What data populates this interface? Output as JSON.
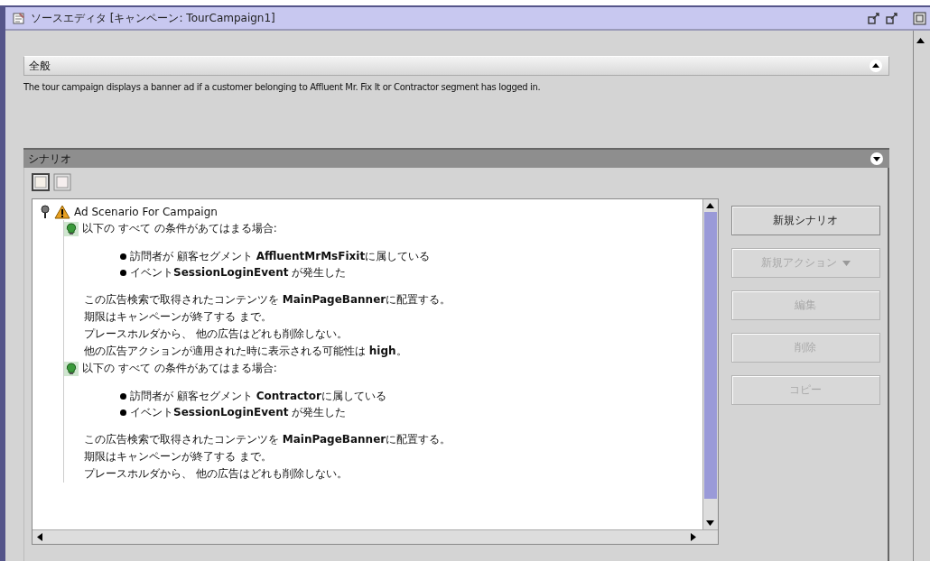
{
  "window": {
    "title": "ソースエディタ [キャンペーン: TourCampaign1]"
  },
  "sections": [
    {
      "kind": "light",
      "title": "全般",
      "description": "The tour campaign displays a banner ad if a customer belonging to Affluent Mr. Fix It or Contractor segment has logged in."
    },
    {
      "kind": "dark",
      "title": "シナリオ",
      "tree": [
        {
          "kind": "scenario",
          "text": "Ad Scenario For Campaign",
          "expanded": true,
          "children": [
            {
              "kind": "condition",
              "text": "以下の すべて の条件があてはまる場合:",
              "children": [
                {
                  "kind": "bullet",
                  "text": "訪問者が 顧客セグメント **AffluentMrMsFixit**に属している"
                },
                {
                  "kind": "bullet",
                  "text": "イベント**SessionLoginEvent** が発生した"
                }
              ]
            },
            {
              "kind": "action",
              "lines": [
                "この広告検索で取得されたコンテンツを **MainPageBanner**に配置する。",
                "期限はキャンペーンが終了する まで。",
                "プレースホルダから、 他の広告はどれも削除しない。",
                "他の広告アクションが適用された時に表示される可能性は **high**。"
              ]
            },
            {
              "kind": "condition",
              "text": "以下の すべて の条件があてはまる場合:",
              "children": [
                {
                  "kind": "bullet",
                  "text": "訪問者が 顧客セグメント **Contractor**に属している"
                },
                {
                  "kind": "bullet",
                  "text": "イベント**SessionLoginEvent** が発生した"
                }
              ]
            },
            {
              "kind": "action",
              "lines": [
                "この広告検索で取得されたコンテンツを **MainPageBanner**に配置する。",
                "期限はキャンペーンが終了する まで。",
                "プレースホルダから、 他の広告はどれも削除しない。"
              ]
            }
          ]
        }
      ],
      "buttons": [
        {
          "label": "新規シナリオ",
          "kind": "plain",
          "disabled": false
        },
        {
          "label": "新規アクション",
          "kind": "menu",
          "disabled": true
        },
        {
          "label": "編集",
          "kind": "plain",
          "disabled": true
        },
        {
          "label": "削除",
          "kind": "plain",
          "disabled": true
        },
        {
          "label": "コピー",
          "kind": "plain",
          "disabled": true
        }
      ]
    }
  ]
}
